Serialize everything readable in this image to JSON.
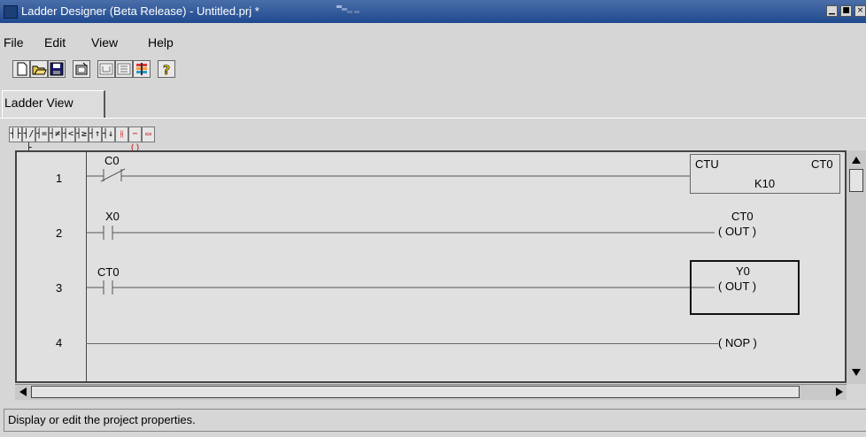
{
  "window": {
    "title": "Ladder Designer (Beta Release) - Untitled.prj *",
    "controls": [
      "minimize",
      "maximize",
      "close"
    ]
  },
  "menu": {
    "items": [
      "File",
      "Edit",
      "View",
      "Help"
    ]
  },
  "toolbar": {
    "icons": [
      "new-file-icon",
      "open-folder-icon",
      "save-disk-icon",
      "properties-icon",
      "ladder-element-icon",
      "grid-icon",
      "color-bars-icon",
      "help-question-icon"
    ]
  },
  "tabs": [
    {
      "label": "Ladder View",
      "active": true
    }
  ],
  "ladder_toolbar": {
    "icons": [
      "no-contact-icon",
      "nc-contact-icon",
      "eq-compare-icon",
      "ne-compare-icon",
      "lt-compare-icon",
      "ge-compare-icon",
      "rising-edge-icon",
      "falling-edge-icon",
      "branch-icon",
      "coil-icon",
      "block-icon"
    ],
    "glyphs": [
      "┤├",
      "┤/├",
      "┤=├",
      "┤≠├",
      "┤<├",
      "┤≥├",
      "┤↑├",
      "┤↓├",
      "⫲",
      "−⟨⟩",
      "▭"
    ]
  },
  "rungs": [
    {
      "number": "1",
      "contact_label": "C0",
      "contact_type": "normally-closed",
      "output_type": "counter-block",
      "block_name": "CTU",
      "block_tag": "CT0",
      "block_param": "K10"
    },
    {
      "number": "2",
      "contact_label": "X0",
      "contact_type": "normally-open",
      "output_type": "coil",
      "coil_tag": "CT0",
      "coil_text": "( OUT )"
    },
    {
      "number": "3",
      "contact_label": "CT0",
      "contact_type": "normally-open",
      "output_type": "coil",
      "coil_tag": "Y0",
      "coil_text": "( OUT )",
      "selected": true
    },
    {
      "number": "4",
      "output_type": "nop",
      "coil_text": "( NOP )"
    }
  ],
  "status": {
    "text": "Display or edit the project properties."
  },
  "colors": {
    "titlebar": "#1f4a8f",
    "background": "#d6d6d6",
    "canvas": "#e0e0e0"
  }
}
